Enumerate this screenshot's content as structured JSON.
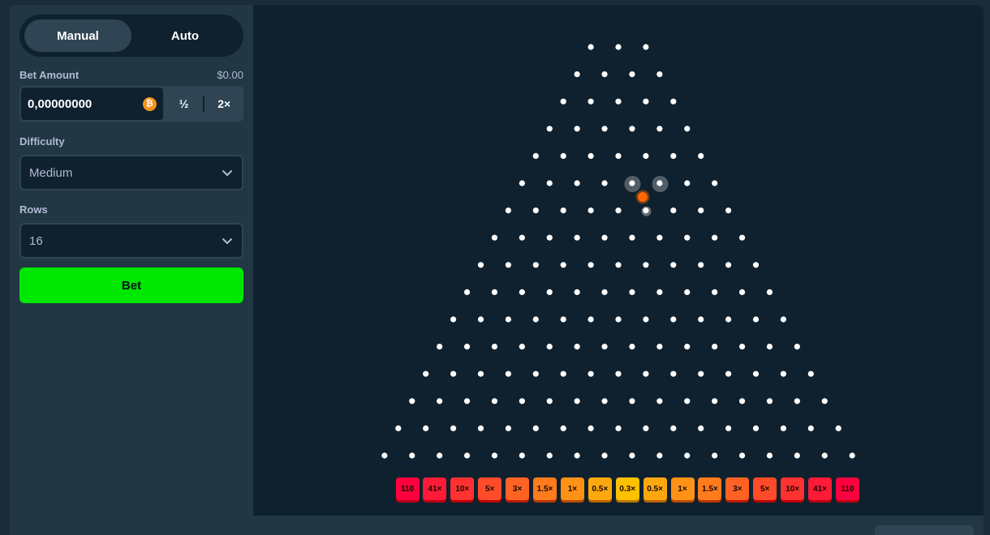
{
  "mode_toggle": {
    "manual": "Manual",
    "auto": "Auto",
    "selected": "Manual"
  },
  "bet_amount": {
    "label": "Bet Amount",
    "usd_value": "$0.00",
    "value": "0,00000000",
    "currency_icon": "bitcoin-icon",
    "half_label": "½",
    "double_label": "2×"
  },
  "difficulty": {
    "label": "Difficulty",
    "value": "Medium"
  },
  "rows": {
    "label": "Rows",
    "value": "16"
  },
  "bet_button": {
    "label": "Bet"
  },
  "board": {
    "rows": 16,
    "buckets": [
      {
        "label": "110",
        "color": "#ff003f"
      },
      {
        "label": "41×",
        "color": "#ff1a38"
      },
      {
        "label": "10×",
        "color": "#ff3131"
      },
      {
        "label": "5×",
        "color": "#ff4b2a"
      },
      {
        "label": "3×",
        "color": "#ff6223"
      },
      {
        "label": "1.5×",
        "color": "#ff7b1c"
      },
      {
        "label": "1×",
        "color": "#ff9215"
      },
      {
        "label": "0.5×",
        "color": "#ffa80e"
      },
      {
        "label": "0.3×",
        "color": "#ffc000"
      },
      {
        "label": "0.5×",
        "color": "#ffa80e"
      },
      {
        "label": "1×",
        "color": "#ff9215"
      },
      {
        "label": "1.5×",
        "color": "#ff7b1c"
      },
      {
        "label": "3×",
        "color": "#ff6223"
      },
      {
        "label": "5×",
        "color": "#ff4b2a"
      },
      {
        "label": "10×",
        "color": "#ff3131"
      },
      {
        "label": "41×",
        "color": "#ff1a38"
      },
      {
        "label": "110",
        "color": "#ff003f"
      }
    ]
  },
  "colors": {
    "accent_green": "#00e701",
    "ball": "#ff6a00",
    "peg": "#ffffff"
  }
}
